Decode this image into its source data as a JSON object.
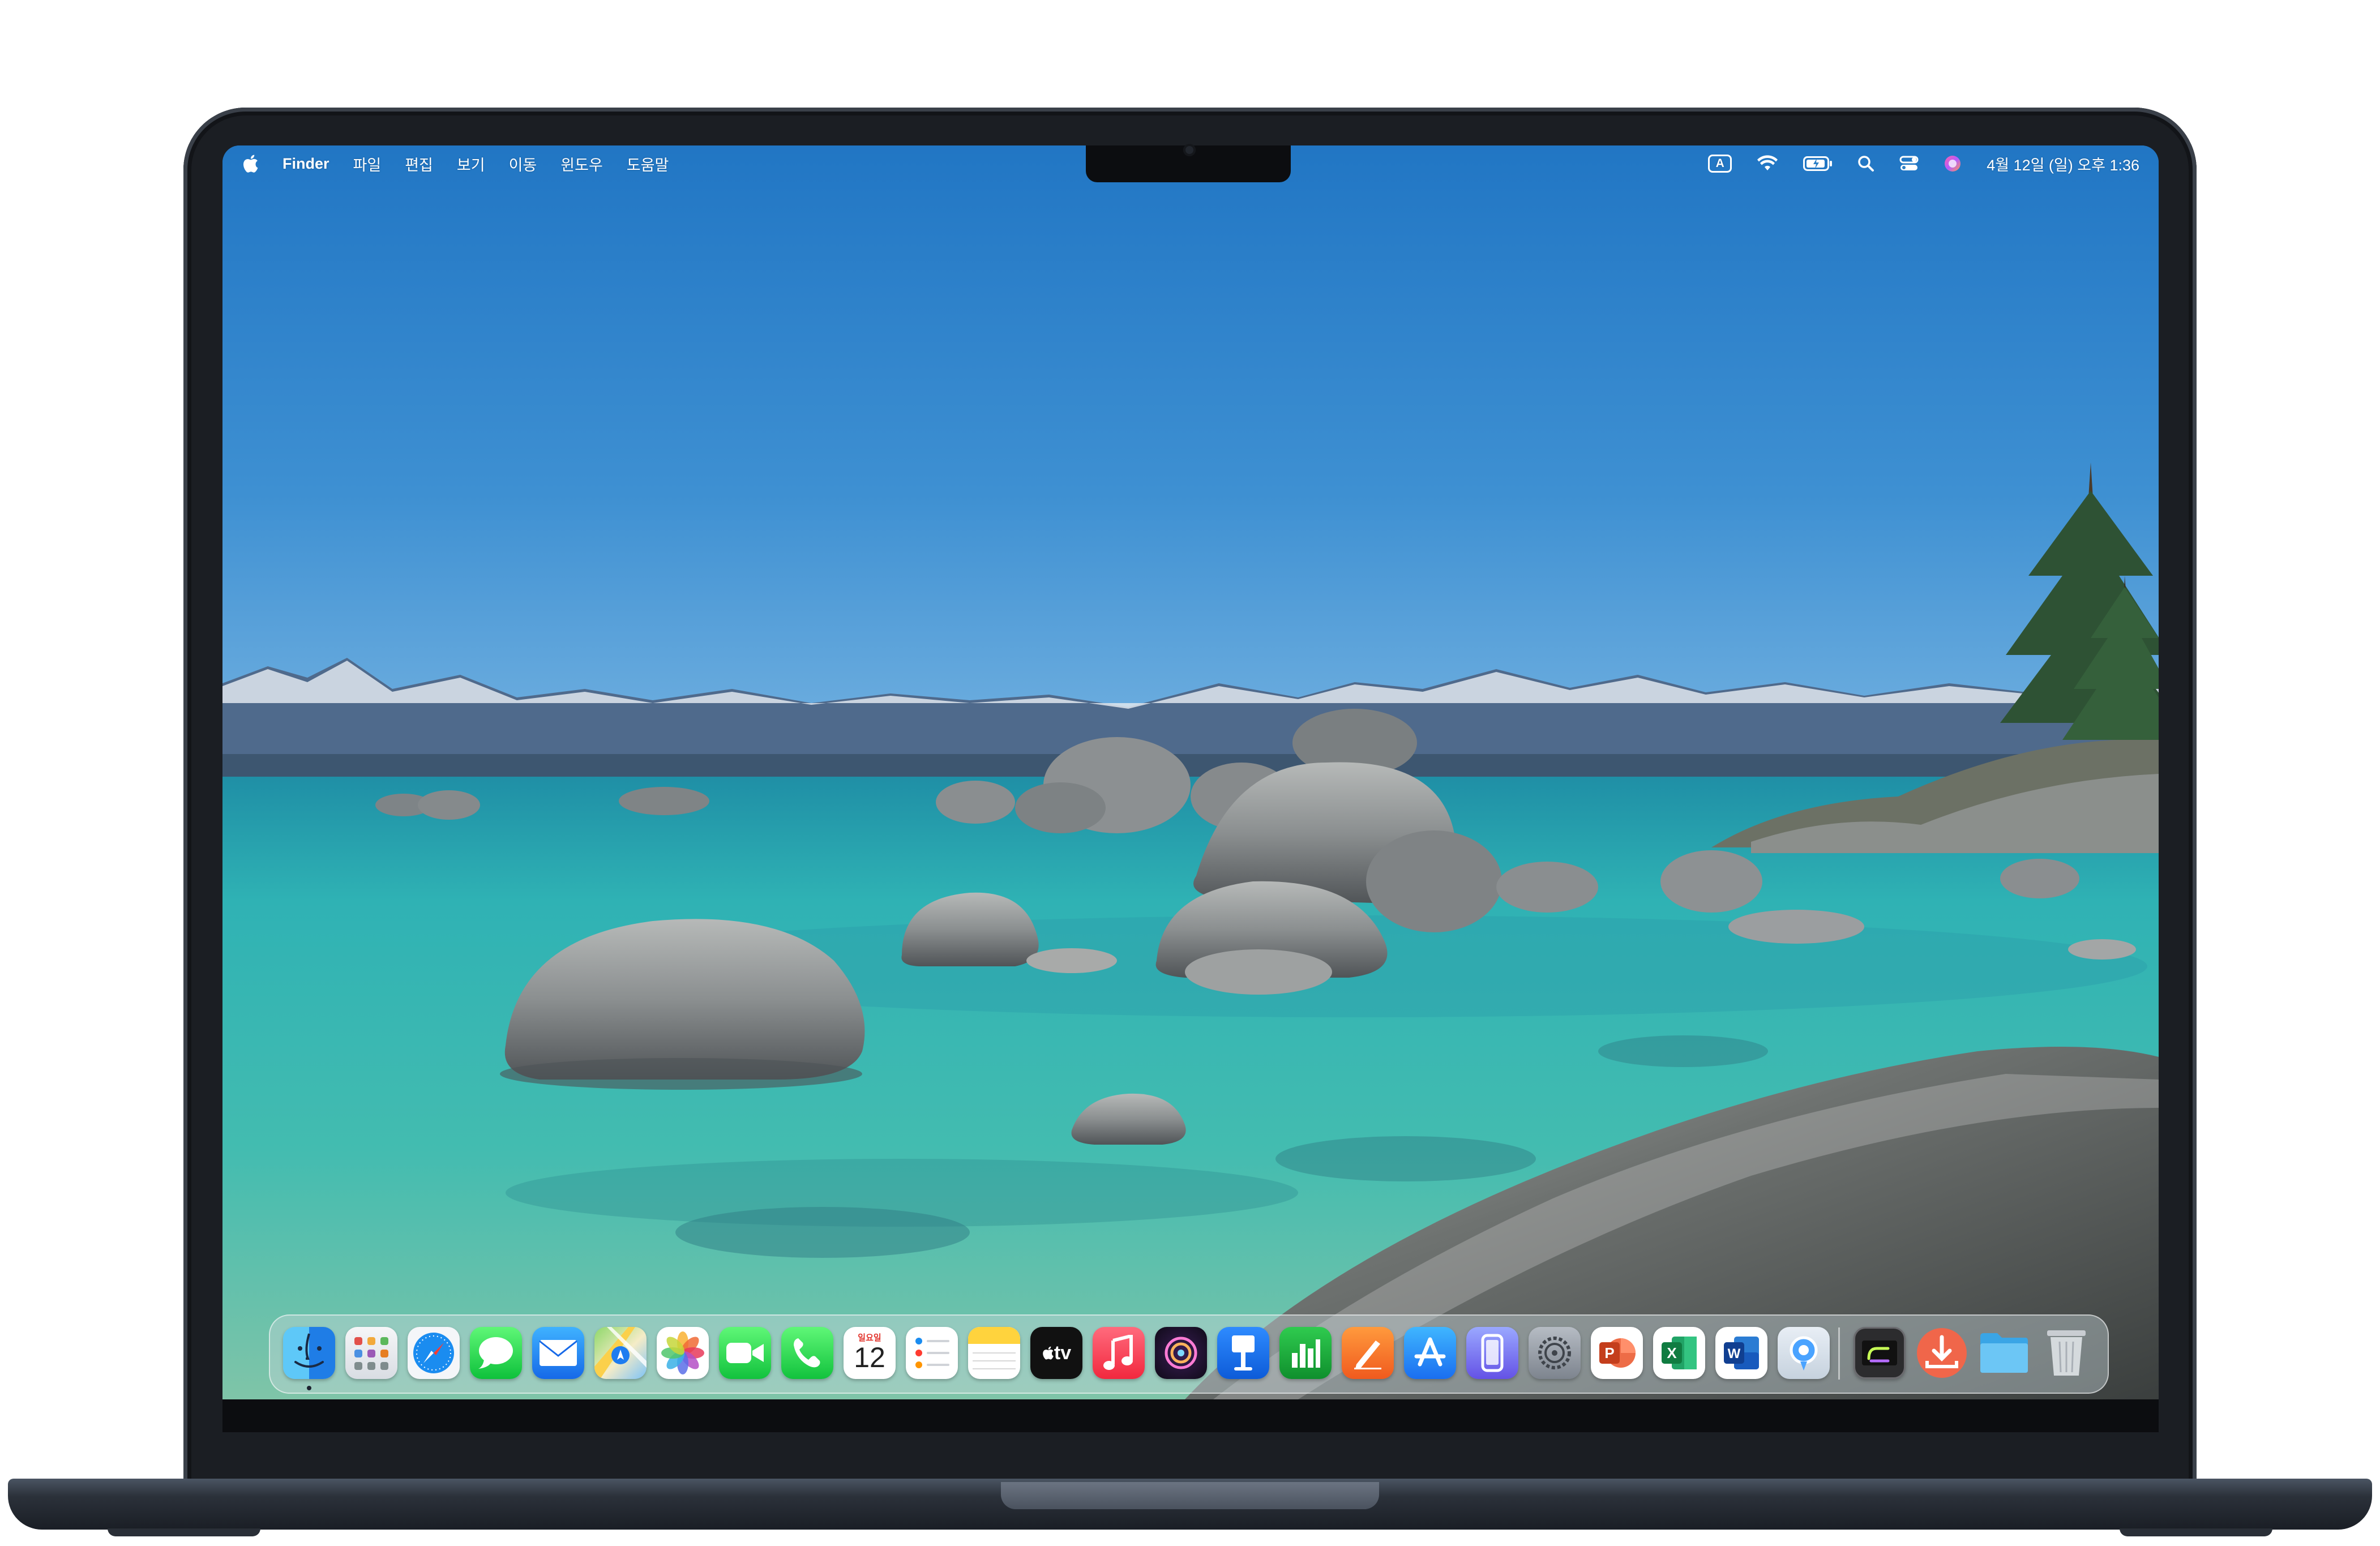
{
  "menubar": {
    "app_name": "Finder",
    "items": [
      "파일",
      "편집",
      "보기",
      "이동",
      "윈도우",
      "도움말"
    ],
    "input_indicator": "A",
    "clock": "4월 12일 (일) 오후 1:36"
  },
  "dock": {
    "apps": [
      {
        "name": "Finder",
        "icon": "finder-icon",
        "running": true
      },
      {
        "name": "Launchpad",
        "icon": "launchpad-icon"
      },
      {
        "name": "Safari",
        "icon": "safari-icon"
      },
      {
        "name": "Messages",
        "icon": "messages-icon"
      },
      {
        "name": "Mail",
        "icon": "mail-icon"
      },
      {
        "name": "Maps",
        "icon": "maps-icon"
      },
      {
        "name": "Photos",
        "icon": "photos-icon"
      },
      {
        "name": "FaceTime",
        "icon": "facetime-icon"
      },
      {
        "name": "Phone",
        "icon": "phone-icon"
      },
      {
        "name": "Calendar",
        "icon": "calendar-icon"
      },
      {
        "name": "Reminders",
        "icon": "reminders-icon"
      },
      {
        "name": "Notes",
        "icon": "notes-icon"
      },
      {
        "name": "TV",
        "icon": "tv-icon"
      },
      {
        "name": "Music",
        "icon": "music-icon"
      },
      {
        "name": "Creator Studio",
        "icon": "creator-icon"
      },
      {
        "name": "Keynote",
        "icon": "keynote-icon"
      },
      {
        "name": "Numbers",
        "icon": "numbers-icon"
      },
      {
        "name": "Pages",
        "icon": "pages-icon"
      },
      {
        "name": "App Store",
        "icon": "app-store-icon"
      },
      {
        "name": "iPhone Mirroring",
        "icon": "iphone-mirroring-icon"
      },
      {
        "name": "System Settings",
        "icon": "system-settings-icon"
      },
      {
        "name": "PowerPoint",
        "icon": "powerpoint-icon"
      },
      {
        "name": "Excel",
        "icon": "excel-icon"
      },
      {
        "name": "Word",
        "icon": "word-icon"
      },
      {
        "name": "Preview",
        "icon": "preview-icon"
      },
      {
        "name": "Terminal",
        "icon": "terminal-icon"
      },
      {
        "name": "Downloader",
        "icon": "downloader-icon"
      },
      {
        "name": "Downloads Folder",
        "icon": "folder-icon"
      },
      {
        "name": "Trash",
        "icon": "trash-icon"
      }
    ],
    "calendar": {
      "month": "일요일",
      "day": "12"
    },
    "tv_label": "tv"
  },
  "colors": {
    "sky": "#2b7fc6",
    "water": "#36b7b4",
    "rock": "#8a8e91",
    "dock_glass": "#c8d6dc"
  }
}
